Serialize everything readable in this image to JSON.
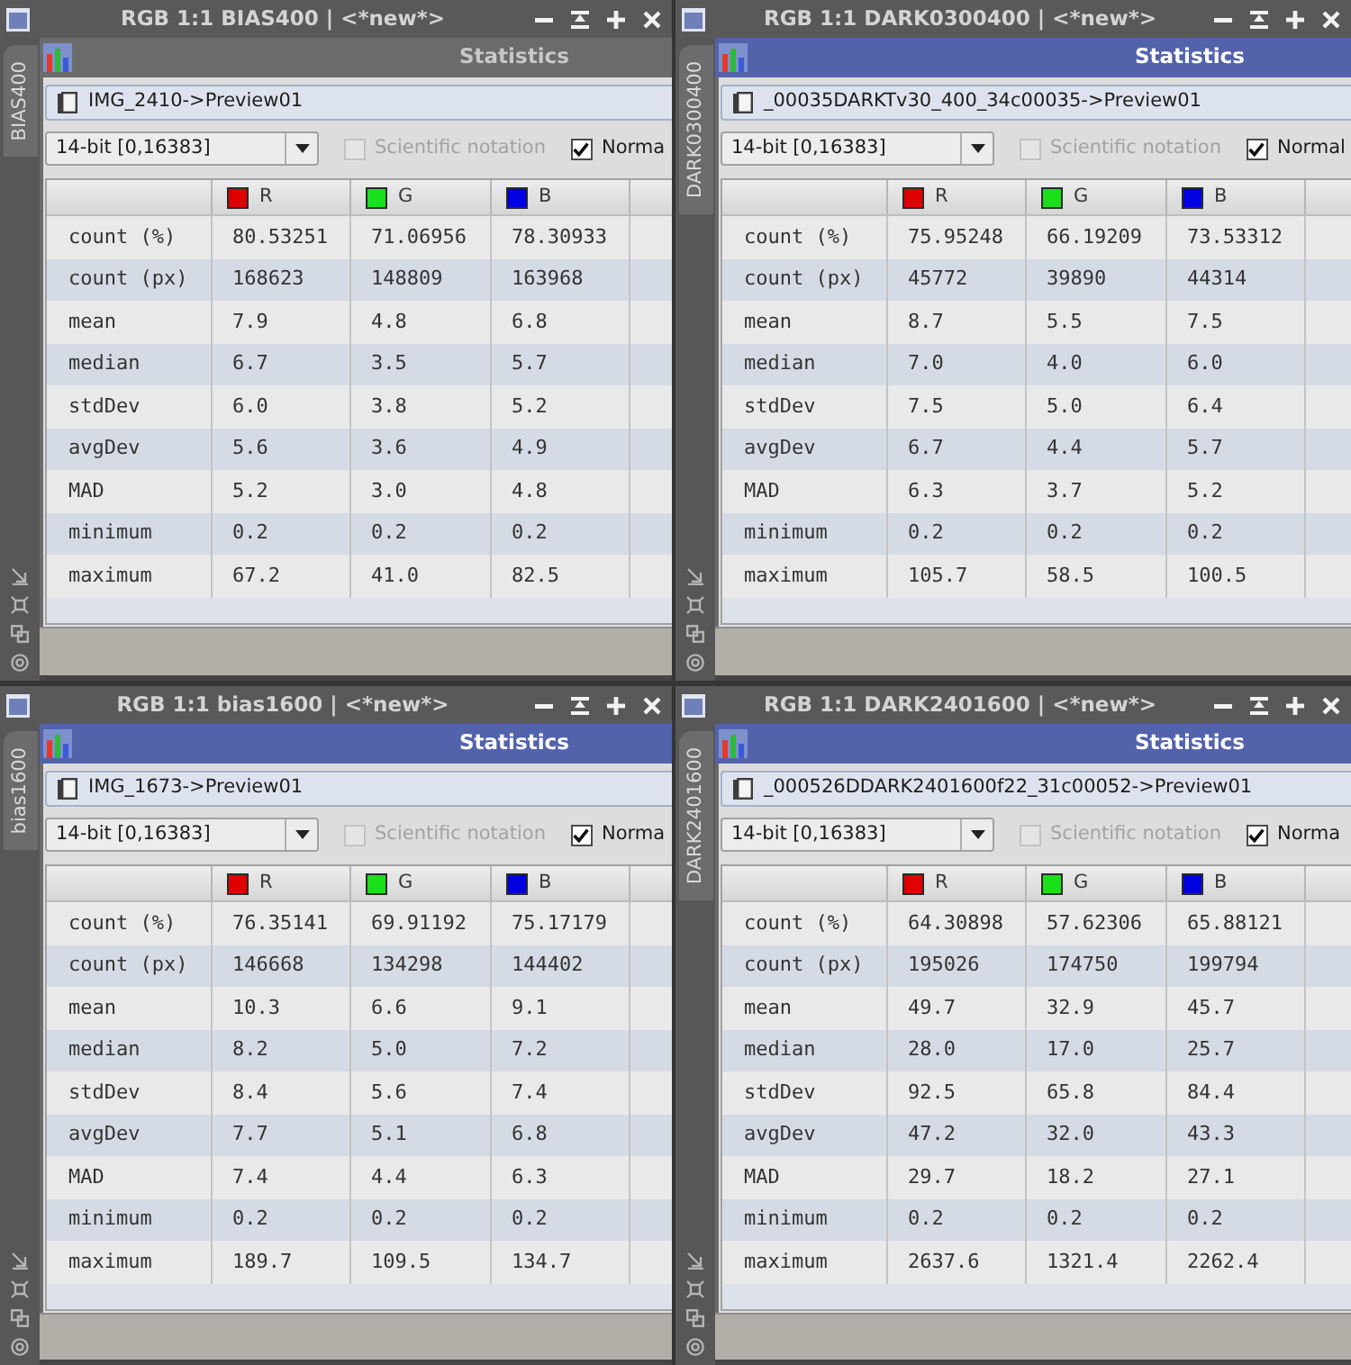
{
  "panels": [
    {
      "window_title": "RGB 1:1 BIAS400 | <*new*>",
      "side_tab": "BIAS400",
      "dialog": {
        "title": "Statistics",
        "active": false
      },
      "view": "IMG_2410->Preview01",
      "range": "14-bit [0,16383]",
      "options": [
        {
          "label": "Scientific notation",
          "checked": false,
          "disabled": true
        },
        {
          "label": "Norma",
          "checked": true,
          "disabled": false
        }
      ],
      "columns": [
        {
          "label": "R",
          "color": "#e00000"
        },
        {
          "label": "G",
          "color": "#19e019"
        },
        {
          "label": "B",
          "color": "#0000e0"
        }
      ],
      "rows": [
        {
          "label": "count (%)",
          "values": [
            "80.53251",
            "71.06956",
            "78.30933"
          ]
        },
        {
          "label": "count (px)",
          "values": [
            "168623",
            "148809",
            "163968"
          ]
        },
        {
          "label": "mean",
          "values": [
            "7.9",
            "4.8",
            "6.8"
          ]
        },
        {
          "label": "median",
          "values": [
            "6.7",
            "3.5",
            "5.7"
          ]
        },
        {
          "label": "stdDev",
          "values": [
            "6.0",
            "3.8",
            "5.2"
          ]
        },
        {
          "label": "avgDev",
          "values": [
            "5.6",
            "3.6",
            "4.9"
          ]
        },
        {
          "label": "MAD",
          "values": [
            "5.2",
            "3.0",
            "4.8"
          ]
        },
        {
          "label": "minimum",
          "values": [
            "0.2",
            "0.2",
            "0.2"
          ]
        },
        {
          "label": "maximum",
          "values": [
            "67.2",
            "41.0",
            "82.5"
          ]
        }
      ]
    },
    {
      "window_title": "RGB 1:1 DARK0300400 | <*new*>",
      "side_tab": "DARK0300400",
      "dialog": {
        "title": "Statistics",
        "active": true
      },
      "view": "_00035DARKTv30_400_34c00035->Preview01",
      "range": "14-bit [0,16383]",
      "options": [
        {
          "label": "Scientific notation",
          "checked": false,
          "disabled": true
        },
        {
          "label": "Normal",
          "checked": true,
          "disabled": false
        }
      ],
      "columns": [
        {
          "label": "R",
          "color": "#e00000"
        },
        {
          "label": "G",
          "color": "#19e019"
        },
        {
          "label": "B",
          "color": "#0000e0"
        }
      ],
      "rows": [
        {
          "label": "count (%)",
          "values": [
            "75.95248",
            "66.19209",
            "73.53312"
          ]
        },
        {
          "label": "count (px)",
          "values": [
            "45772",
            "39890",
            "44314"
          ]
        },
        {
          "label": "mean",
          "values": [
            "8.7",
            "5.5",
            "7.5"
          ]
        },
        {
          "label": "median",
          "values": [
            "7.0",
            "4.0",
            "6.0"
          ]
        },
        {
          "label": "stdDev",
          "values": [
            "7.5",
            "5.0",
            "6.4"
          ]
        },
        {
          "label": "avgDev",
          "values": [
            "6.7",
            "4.4",
            "5.7"
          ]
        },
        {
          "label": "MAD",
          "values": [
            "6.3",
            "3.7",
            "5.2"
          ]
        },
        {
          "label": "minimum",
          "values": [
            "0.2",
            "0.2",
            "0.2"
          ]
        },
        {
          "label": "maximum",
          "values": [
            "105.7",
            "58.5",
            "100.5"
          ]
        }
      ]
    },
    {
      "window_title": "RGB 1:1 bias1600 | <*new*>",
      "side_tab": "bias1600",
      "dialog": {
        "title": "Statistics",
        "active": true
      },
      "view": "IMG_1673->Preview01",
      "range": "14-bit [0,16383]",
      "options": [
        {
          "label": "Scientific notation",
          "checked": false,
          "disabled": true
        },
        {
          "label": "Norma",
          "checked": true,
          "disabled": false
        }
      ],
      "columns": [
        {
          "label": "R",
          "color": "#e00000"
        },
        {
          "label": "G",
          "color": "#19e019"
        },
        {
          "label": "B",
          "color": "#0000e0"
        }
      ],
      "rows": [
        {
          "label": "count (%)",
          "values": [
            "76.35141",
            "69.91192",
            "75.17179"
          ]
        },
        {
          "label": "count (px)",
          "values": [
            "146668",
            "134298",
            "144402"
          ]
        },
        {
          "label": "mean",
          "values": [
            "10.3",
            "6.6",
            "9.1"
          ]
        },
        {
          "label": "median",
          "values": [
            "8.2",
            "5.0",
            "7.2"
          ]
        },
        {
          "label": "stdDev",
          "values": [
            "8.4",
            "5.6",
            "7.4"
          ]
        },
        {
          "label": "avgDev",
          "values": [
            "7.7",
            "5.1",
            "6.8"
          ]
        },
        {
          "label": "MAD",
          "values": [
            "7.4",
            "4.4",
            "6.3"
          ]
        },
        {
          "label": "minimum",
          "values": [
            "0.2",
            "0.2",
            "0.2"
          ]
        },
        {
          "label": "maximum",
          "values": [
            "189.7",
            "109.5",
            "134.7"
          ]
        }
      ]
    },
    {
      "window_title": "RGB 1:1 DARK2401600 | <*new*>",
      "side_tab": "DARK2401600",
      "dialog": {
        "title": "Statistics",
        "active": true
      },
      "view": "_000526DDARK2401600f22_31c00052->Preview01",
      "range": "14-bit [0,16383]",
      "options": [
        {
          "label": "Scientific notation",
          "checked": false,
          "disabled": true
        },
        {
          "label": "Norma",
          "checked": true,
          "disabled": false
        }
      ],
      "columns": [
        {
          "label": "R",
          "color": "#e00000"
        },
        {
          "label": "G",
          "color": "#19e019"
        },
        {
          "label": "B",
          "color": "#0000e0"
        }
      ],
      "rows": [
        {
          "label": "count (%)",
          "values": [
            "64.30898",
            "57.62306",
            "65.88121"
          ]
        },
        {
          "label": "count (px)",
          "values": [
            "195026",
            "174750",
            "199794"
          ]
        },
        {
          "label": "mean",
          "values": [
            "49.7",
            "32.9",
            "45.7"
          ]
        },
        {
          "label": "median",
          "values": [
            "28.0",
            "17.0",
            "25.7"
          ]
        },
        {
          "label": "stdDev",
          "values": [
            "92.5",
            "65.8",
            "84.4"
          ]
        },
        {
          "label": "avgDev",
          "values": [
            "47.2",
            "32.0",
            "43.3"
          ]
        },
        {
          "label": "MAD",
          "values": [
            "29.7",
            "18.2",
            "27.1"
          ]
        },
        {
          "label": "minimum",
          "values": [
            "0.2",
            "0.2",
            "0.2"
          ]
        },
        {
          "label": "maximum",
          "values": [
            "2637.6",
            "1321.4",
            "2262.4"
          ]
        }
      ]
    }
  ]
}
